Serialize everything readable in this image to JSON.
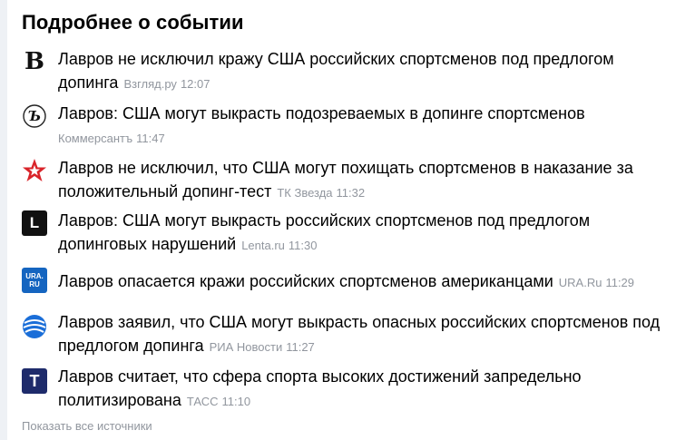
{
  "header": {
    "title": "Подробнее о событии"
  },
  "items": [
    {
      "headline": "Лавров не исключил кражу США российских спортсменов под предлогом допинга",
      "source": "Взгляд.ру",
      "time": "12:07",
      "logo": "vzglyad-logo"
    },
    {
      "headline": "Лавров: США могут выкрасть подозреваемых в допинге спортсменов",
      "source": "Коммерсантъ",
      "time": "11:47",
      "logo": "kommersant-logo"
    },
    {
      "headline": "Лавров не исключил, что США могут похищать спортсменов в наказание за положительный допинг-тест",
      "source": "ТК Звезда",
      "time": "11:32",
      "logo": "zvezda-logo"
    },
    {
      "headline": "Лавров: США могут выкрасть российских спортсменов под предлогом допинговых нарушений",
      "source": "Lenta.ru",
      "time": "11:30",
      "logo": "lenta-logo"
    },
    {
      "headline": "Лавров опасается кражи российских спортсменов американцами",
      "source": "URA.Ru",
      "time": "11:29",
      "logo": "ura-logo"
    },
    {
      "headline": "Лавров заявил, что США могут выкрасть опасных российских спортсменов под предлогом допинга",
      "source": "РИА Новости",
      "time": "11:27",
      "logo": "ria-logo"
    },
    {
      "headline": "Лавров считает, что сфера спорта высоких достижений запредельно политизирована",
      "source": "ТАСС",
      "time": "11:10",
      "logo": "tass-logo"
    }
  ],
  "footer": {
    "all_sources_label": "Показать все источники"
  },
  "logo_texts": {
    "ura": "URA.RU",
    "lenta": "L",
    "tass": "T",
    "vzglyad": "B"
  },
  "colors": {
    "meta": "#91969e",
    "zvezda": "#d9242a",
    "ria": "#1a6ed8",
    "ura": "#1565c0",
    "tass": "#1e2b6b"
  }
}
